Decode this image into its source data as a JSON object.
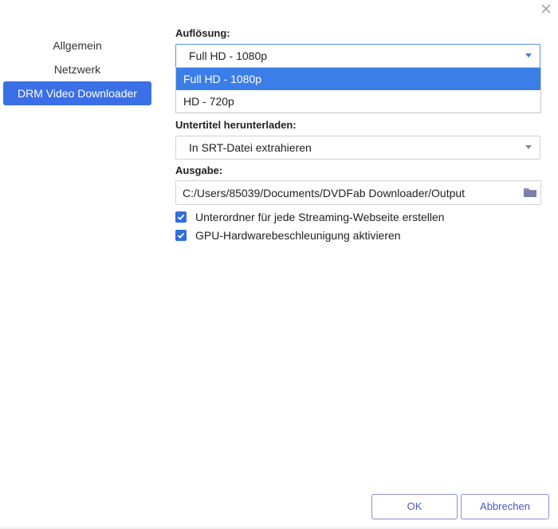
{
  "sidebar": {
    "items": [
      {
        "label": "Allgemein",
        "active": false
      },
      {
        "label": "Netzwerk",
        "active": false
      },
      {
        "label": "DRM Video Downloader",
        "active": true
      }
    ]
  },
  "resolution": {
    "label": "Auflösung:",
    "selected": "Full HD - 1080p",
    "options": [
      "Full HD - 1080p",
      "HD - 720p"
    ]
  },
  "subtitles": {
    "label": "Untertitel herunterladen:",
    "selected": "In SRT-Datei extrahieren"
  },
  "output": {
    "label": "Ausgabe:",
    "path": "C:/Users/85039/Documents/DVDFab Downloader/Output"
  },
  "options": [
    {
      "label": "Unterordner für jede Streaming-Webseite erstellen",
      "checked": true
    },
    {
      "label": "GPU-Hardwarebeschleunigung aktivieren",
      "checked": true
    }
  ],
  "footer": {
    "ok_label": "OK",
    "cancel_label": "Abbrechen"
  },
  "colors": {
    "accent": "#3b6fe6",
    "dropdown_highlight": "#3b7ee8",
    "button_text": "#4b57c8"
  },
  "icons": {
    "close": "close-icon",
    "folder": "folder-icon",
    "caret": "chevron-down-icon",
    "check": "check-icon"
  }
}
